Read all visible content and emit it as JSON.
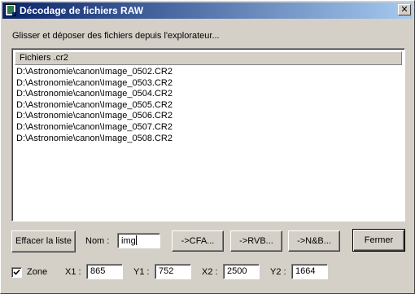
{
  "window": {
    "title": "Décodage de fichiers RAW",
    "close_label": "✕"
  },
  "instruction": "Glisser et déposer des fichiers depuis l'explorateur...",
  "file_list": {
    "header": "Fichiers .cr2",
    "items": [
      "D:\\Astronomie\\canon\\Image_0502.CR2",
      "D:\\Astronomie\\canon\\Image_0503.CR2",
      "D:\\Astronomie\\canon\\Image_0504.CR2",
      "D:\\Astronomie\\canon\\Image_0505.CR2",
      "D:\\Astronomie\\canon\\Image_0506.CR2",
      "D:\\Astronomie\\canon\\Image_0507.CR2",
      "D:\\Astronomie\\canon\\Image_0508.CR2"
    ]
  },
  "controls": {
    "clear_label": "Effacer la liste",
    "name_label": "Nom :",
    "name_value": "img",
    "cfa_label": "->CFA...",
    "rvb_label": "->RVB...",
    "nb_label": "->N&B...",
    "close_button_label": "Fermer"
  },
  "zone": {
    "checkbox_label": "Zone",
    "checked": true,
    "x1_label": "X1 :",
    "x1_value": "865",
    "y1_label": "Y1 :",
    "y1_value": "752",
    "x2_label": "X2 :",
    "x2_value": "2500",
    "y2_label": "Y2 :",
    "y2_value": "1664"
  },
  "icons": {
    "app": "app-icon",
    "close": "close-icon",
    "check": "check-icon"
  }
}
